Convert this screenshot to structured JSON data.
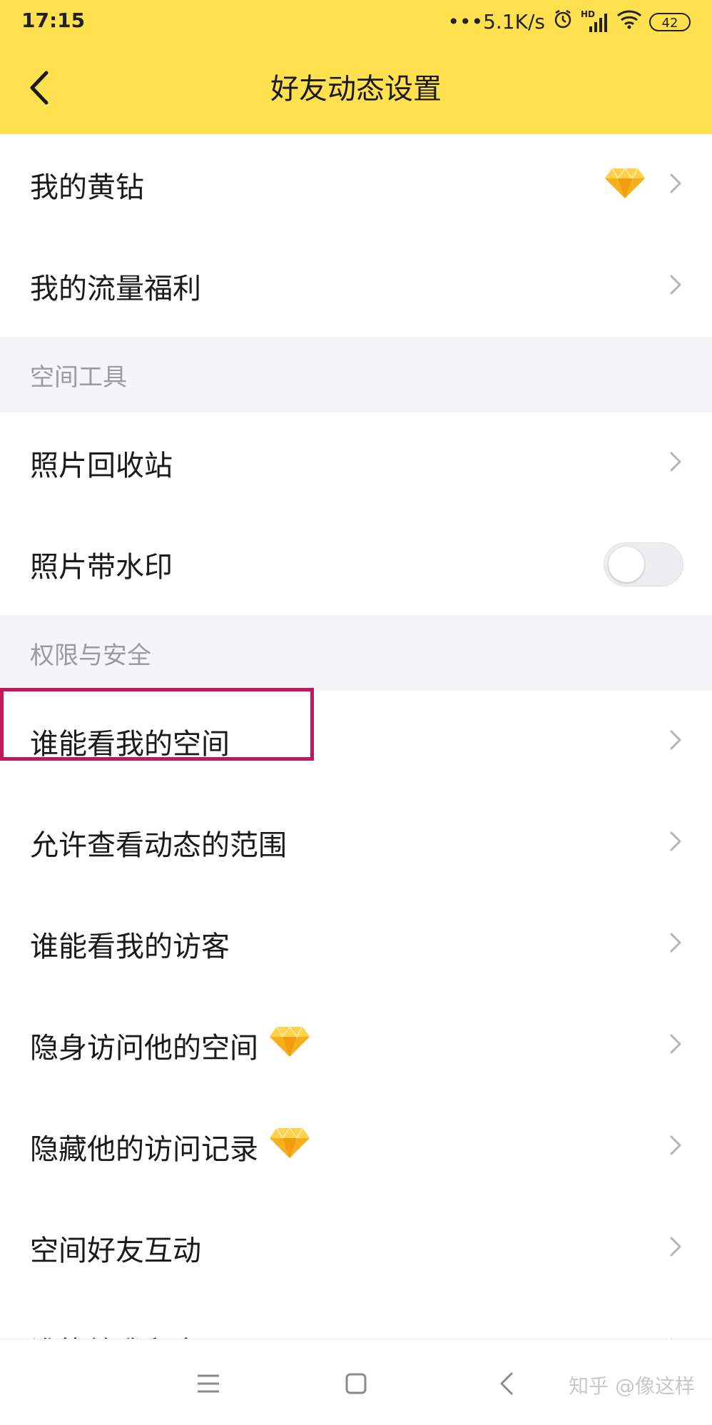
{
  "status_bar": {
    "time": "17:15",
    "network_speed": "•••5.1K/s",
    "signal_tag": "HD",
    "battery": "42"
  },
  "header": {
    "title": "好友动态设置"
  },
  "rows_top": [
    {
      "label": "我的黄钻",
      "has_diamond": true
    },
    {
      "label": "我的流量福利"
    }
  ],
  "section_tools": {
    "title": "空间工具",
    "rows": [
      {
        "label": "照片回收站"
      },
      {
        "label": "照片带水印",
        "toggle": "off"
      }
    ]
  },
  "section_security": {
    "title": "权限与安全",
    "rows": [
      {
        "label": "谁能看我的空间"
      },
      {
        "label": "允许查看动态的范围"
      },
      {
        "label": "谁能看我的访客"
      },
      {
        "label": "隐身访问他的空间"
      },
      {
        "label": "隐藏他的访问记录"
      },
      {
        "label": "空间好友互动"
      },
      {
        "label": "谁能给我留言"
      }
    ]
  },
  "watermark": "知乎 @像这样",
  "colors": {
    "header_bg": "#FFE150",
    "section_bg": "#F5F5F7",
    "highlight": "#C2185B"
  },
  "icons": {
    "back": "chevron-left-icon",
    "chevron": "chevron-right-icon",
    "diamond": "yellow-diamond-icon",
    "menu": "menu-icon",
    "home": "home-square-icon",
    "nav_back": "back-triangle-icon"
  }
}
